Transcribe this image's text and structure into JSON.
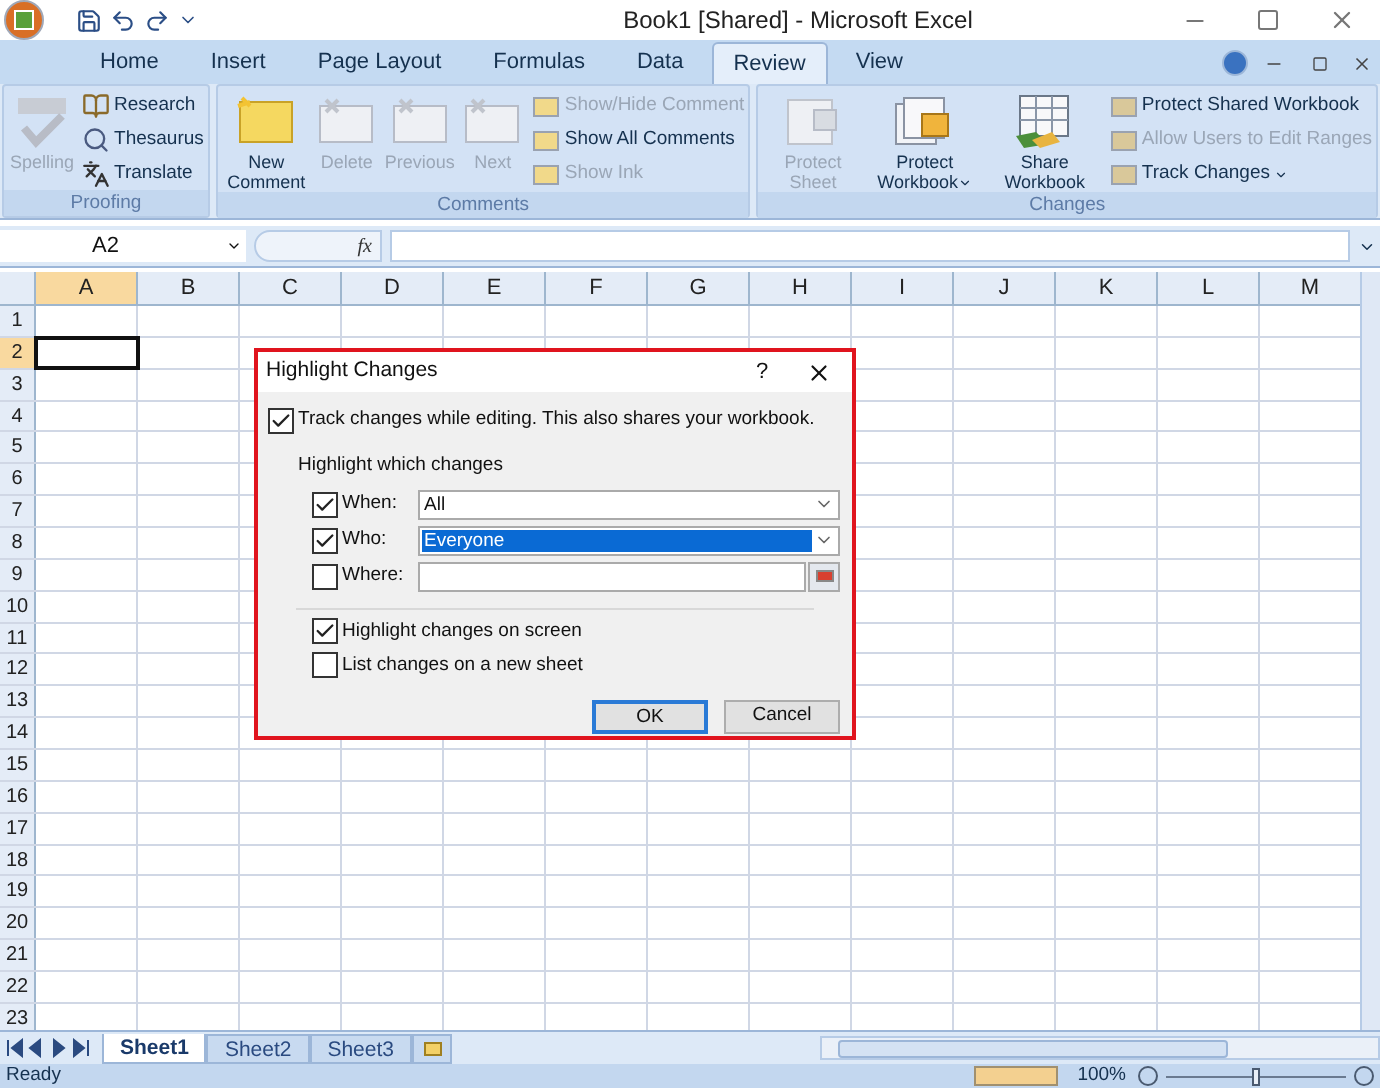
{
  "window": {
    "title": "Book1  [Shared] - Microsoft Excel"
  },
  "tabs": [
    {
      "label": "Home",
      "selected": false
    },
    {
      "label": "Insert",
      "selected": false
    },
    {
      "label": "Page Layout",
      "selected": false
    },
    {
      "label": "Formulas",
      "selected": false
    },
    {
      "label": "Data",
      "selected": false
    },
    {
      "label": "Review",
      "selected": true
    },
    {
      "label": "View",
      "selected": false
    }
  ],
  "ribbon_groups": [
    {
      "label": "Proofing",
      "items": [
        {
          "kind": "large",
          "label": "Spelling",
          "disabled": true
        },
        {
          "kind": "small",
          "label": "Research",
          "disabled": false
        },
        {
          "kind": "small",
          "label": "Thesaurus",
          "disabled": false
        },
        {
          "kind": "small",
          "label": "Translate",
          "disabled": false
        }
      ]
    },
    {
      "label": "Comments",
      "items": [
        {
          "kind": "large",
          "label": "New Comment",
          "disabled": false
        },
        {
          "kind": "large",
          "label": "Delete",
          "disabled": true
        },
        {
          "kind": "large",
          "label": "Previous",
          "disabled": true
        },
        {
          "kind": "large",
          "label": "Next",
          "disabled": true
        },
        {
          "kind": "small",
          "label": "Show/Hide Comment",
          "disabled": true
        },
        {
          "kind": "small",
          "label": "Show All Comments",
          "disabled": false
        },
        {
          "kind": "small",
          "label": "Show Ink",
          "disabled": true
        }
      ]
    },
    {
      "label": "Changes",
      "items": [
        {
          "kind": "large",
          "label": "Protect Sheet",
          "disabled": true,
          "dropdown": false
        },
        {
          "kind": "large",
          "label": "Protect Workbook",
          "disabled": false,
          "dropdown": true
        },
        {
          "kind": "large",
          "label": "Share Workbook",
          "disabled": false,
          "dropdown": false
        },
        {
          "kind": "small",
          "label": "Protect Shared Workbook",
          "disabled": false,
          "dropdown": false
        },
        {
          "kind": "small",
          "label": "Allow Users to Edit Ranges",
          "disabled": true,
          "dropdown": false
        },
        {
          "kind": "small",
          "label": "Track Changes",
          "disabled": false,
          "dropdown": true
        }
      ]
    }
  ],
  "formula_bar": {
    "name_box": "A2",
    "function_label": "fx"
  },
  "columns": [
    {
      "label": "A",
      "selected": true
    },
    {
      "label": "B",
      "selected": false
    },
    {
      "label": "C",
      "selected": false
    },
    {
      "label": "D",
      "selected": false
    },
    {
      "label": "E",
      "selected": false
    },
    {
      "label": "F",
      "selected": false
    },
    {
      "label": "G",
      "selected": false
    },
    {
      "label": "H",
      "selected": false
    },
    {
      "label": "I",
      "selected": false
    },
    {
      "label": "J",
      "selected": false
    },
    {
      "label": "K",
      "selected": false
    },
    {
      "label": "L",
      "selected": false
    },
    {
      "label": "M",
      "selected": false
    }
  ],
  "rows": [
    {
      "label": "1",
      "selected": false
    },
    {
      "label": "2",
      "selected": true
    },
    {
      "label": "3",
      "selected": false
    },
    {
      "label": "4",
      "selected": false
    },
    {
      "label": "5",
      "selected": false
    },
    {
      "label": "6",
      "selected": false
    },
    {
      "label": "7",
      "selected": false
    },
    {
      "label": "8",
      "selected": false
    },
    {
      "label": "9",
      "selected": false
    },
    {
      "label": "10",
      "selected": false
    },
    {
      "label": "11",
      "selected": false
    },
    {
      "label": "12",
      "selected": false
    },
    {
      "label": "13",
      "selected": false
    },
    {
      "label": "14",
      "selected": false
    },
    {
      "label": "15",
      "selected": false
    },
    {
      "label": "16",
      "selected": false
    },
    {
      "label": "17",
      "selected": false
    },
    {
      "label": "18",
      "selected": false
    },
    {
      "label": "19",
      "selected": false
    },
    {
      "label": "20",
      "selected": false
    },
    {
      "label": "21",
      "selected": false
    },
    {
      "label": "22",
      "selected": false
    },
    {
      "label": "23",
      "selected": false
    }
  ],
  "dialog": {
    "title": "Highlight Changes",
    "help": "?",
    "track": {
      "label": "Track changes while editing. This also shares your workbook.",
      "checked": true
    },
    "group_label": "Highlight which changes",
    "fields": [
      {
        "kind": "dropdown",
        "label": "When:",
        "checked": true,
        "value": "All",
        "selected": false
      },
      {
        "kind": "dropdown",
        "label": "Who:",
        "checked": true,
        "value": "Everyone",
        "selected": true
      },
      {
        "kind": "range",
        "label": "Where:",
        "checked": false
      }
    ],
    "options": [
      {
        "label": "Highlight changes on screen",
        "checked": true
      },
      {
        "label": "List changes on a new sheet",
        "checked": false
      }
    ],
    "buttons": [
      {
        "label": "OK",
        "default": true
      },
      {
        "label": "Cancel",
        "default": false
      }
    ]
  },
  "sheet_tabs": [
    {
      "label": "Sheet1",
      "selected": true
    },
    {
      "label": "Sheet2",
      "selected": false
    },
    {
      "label": "Sheet3",
      "selected": false
    }
  ],
  "status_bar": {
    "status": "Ready",
    "zoom": "100%",
    "zoom_slider": {
      "level": 0.5
    }
  }
}
